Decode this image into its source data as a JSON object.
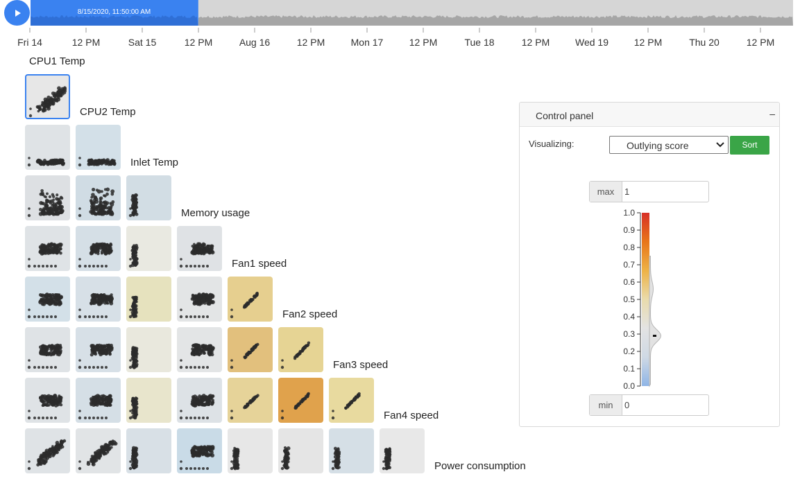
{
  "timeline": {
    "current_time": "8/15/2020, 11:50:00 AM",
    "progress": 0.22,
    "ticks": [
      "Fri 14",
      "12 PM",
      "Sat 15",
      "12 PM",
      "Aug 16",
      "12 PM",
      "Mon 17",
      "12 PM",
      "Tue 18",
      "12 PM",
      "Wed 19",
      "12 PM",
      "Thu 20",
      "12 PM"
    ],
    "play_icon": "play-icon",
    "colors": {
      "played": "#3a82f0",
      "remaining": "#b8b8b8",
      "played_wave": "#2f6fd6",
      "remaining_wave": "#a6a6a6"
    }
  },
  "variables": [
    "CPU1 Temp",
    "CPU2 Temp",
    "Inlet Temp",
    "Memory usage",
    "Fan1 speed",
    "Fan2 speed",
    "Fan3 speed",
    "Fan4 speed",
    "Power consumption"
  ],
  "matrix": {
    "selected": "CPU1 Temp / CPU1 Temp",
    "cells": [
      {
        "row": 0,
        "col": 0,
        "color": "#e7e7e7",
        "shape": "diag"
      },
      {
        "row": 1,
        "col": 0,
        "color": "#dfe3e6",
        "shape": "flat"
      },
      {
        "row": 1,
        "col": 1,
        "color": "#d3e0e8",
        "shape": "flat"
      },
      {
        "row": 2,
        "col": 0,
        "color": "#dde0e3",
        "shape": "spread"
      },
      {
        "row": 2,
        "col": 1,
        "color": "#d0dce4",
        "shape": "spread"
      },
      {
        "row": 2,
        "col": 2,
        "color": "#d2dde4",
        "shape": "column"
      },
      {
        "row": 3,
        "col": 0,
        "color": "#dfe3e6",
        "shape": "blob"
      },
      {
        "row": 3,
        "col": 1,
        "color": "#d5dfe6",
        "shape": "blob"
      },
      {
        "row": 3,
        "col": 2,
        "color": "#e9e9e1",
        "shape": "column"
      },
      {
        "row": 3,
        "col": 3,
        "color": "#dfe2e5",
        "shape": "blob"
      },
      {
        "row": 4,
        "col": 0,
        "color": "#d3e0e8",
        "shape": "blob"
      },
      {
        "row": 4,
        "col": 1,
        "color": "#d7e0e7",
        "shape": "blob"
      },
      {
        "row": 4,
        "col": 2,
        "color": "#e6e2be",
        "shape": "column"
      },
      {
        "row": 4,
        "col": 3,
        "color": "#e3e5e6",
        "shape": "blob"
      },
      {
        "row": 4,
        "col": 4,
        "color": "#e6cf8f",
        "shape": "line"
      },
      {
        "row": 5,
        "col": 0,
        "color": "#dfe3e6",
        "shape": "blob"
      },
      {
        "row": 5,
        "col": 1,
        "color": "#d7e0e7",
        "shape": "blob"
      },
      {
        "row": 5,
        "col": 2,
        "color": "#e9e8dd",
        "shape": "column"
      },
      {
        "row": 5,
        "col": 3,
        "color": "#e3e5e6",
        "shape": "blob"
      },
      {
        "row": 5,
        "col": 4,
        "color": "#e2c07d",
        "shape": "line"
      },
      {
        "row": 5,
        "col": 5,
        "color": "#e6d494",
        "shape": "line"
      },
      {
        "row": 6,
        "col": 0,
        "color": "#dfe3e6",
        "shape": "blob"
      },
      {
        "row": 6,
        "col": 1,
        "color": "#d5dfe6",
        "shape": "blob"
      },
      {
        "row": 6,
        "col": 2,
        "color": "#e8e5cc",
        "shape": "column"
      },
      {
        "row": 6,
        "col": 3,
        "color": "#dde2e6",
        "shape": "blob"
      },
      {
        "row": 6,
        "col": 4,
        "color": "#e6d399",
        "shape": "line"
      },
      {
        "row": 6,
        "col": 5,
        "color": "#e0a24c",
        "shape": "line"
      },
      {
        "row": 6,
        "col": 6,
        "color": "#e8da9f",
        "shape": "line"
      },
      {
        "row": 7,
        "col": 0,
        "color": "#dfe3e6",
        "shape": "diag"
      },
      {
        "row": 7,
        "col": 1,
        "color": "#e1e4e6",
        "shape": "diag"
      },
      {
        "row": 7,
        "col": 2,
        "color": "#d8e0e6",
        "shape": "column"
      },
      {
        "row": 7,
        "col": 3,
        "color": "#c9dbe7",
        "shape": "blob"
      },
      {
        "row": 7,
        "col": 4,
        "color": "#e7e7e7",
        "shape": "column"
      },
      {
        "row": 7,
        "col": 5,
        "color": "#e5e5e5",
        "shape": "column"
      },
      {
        "row": 7,
        "col": 6,
        "color": "#d5dfe6",
        "shape": "column"
      },
      {
        "row": 7,
        "col": 7,
        "color": "#e8e8e8",
        "shape": "column"
      }
    ]
  },
  "control_panel": {
    "title": "Control panel",
    "collapse_symbol": "–",
    "visualizing_label": "Visualizing:",
    "selected_option": "Outlying score",
    "sort_label": "Sort",
    "max_label": "max",
    "max_value": "1",
    "min_label": "min",
    "min_value": "0",
    "colorbar": {
      "ticks": [
        "1.0",
        "0.9",
        "0.8",
        "0.7",
        "0.6",
        "0.5",
        "0.4",
        "0.3",
        "0.2",
        "0.1",
        "0.0"
      ],
      "colors": [
        "#d73027",
        "#e8751a",
        "#eeb245",
        "#e9dbac",
        "#e3e3e3",
        "#cfd9e5",
        "#8fb5e6"
      ],
      "density_peak": 0.29,
      "marker_value": 0.29
    },
    "sort_color": "#3aa547"
  }
}
